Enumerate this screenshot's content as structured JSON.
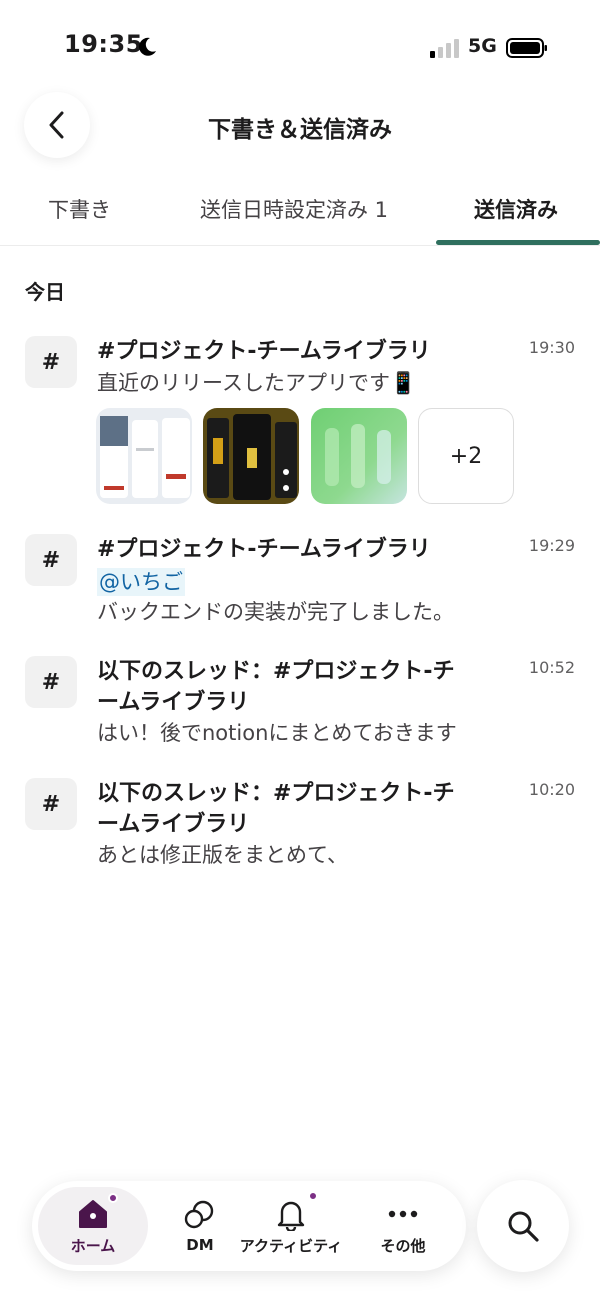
{
  "status_bar": {
    "time": "19:35",
    "network": "5G"
  },
  "header": {
    "title": "下書き＆送信済み"
  },
  "tabs": [
    {
      "label": "下書き",
      "active": false
    },
    {
      "label": "送信日時設定済み 1",
      "active": false
    },
    {
      "label": "送信済み",
      "active": true
    }
  ],
  "section": {
    "title": "今日"
  },
  "messages": [
    {
      "channel": "#プロジェクト-チームライブラリ",
      "time": "19:30",
      "text": "直近のリリースしたアプリです📱",
      "attachments_more": "+2"
    },
    {
      "channel": "#プロジェクト-チームライブラリ",
      "time": "19:29",
      "mention": "@いちご",
      "text": "バックエンドの実装が完了しました。"
    },
    {
      "channel_line1": "以下のスレッド：#プロジェクト-チ",
      "channel_line2": "ームライブラリ",
      "time": "10:52",
      "text": "はい！後でnotionにまとめておきます"
    },
    {
      "channel_line1": "以下のスレッド：#プロジェクト-チ",
      "channel_line2": "ームライブラリ",
      "time": "10:20",
      "text": "あとは修正版をまとめて、"
    }
  ],
  "hash_symbol": "#",
  "nav": {
    "home": "ホーム",
    "dm": "DM",
    "activity": "アクティビティ",
    "more": "その他"
  },
  "colors": {
    "accent_tab": "#2f6f5e",
    "badge": "#7c3085",
    "mention": "#1264a3",
    "home_active": "#4a154b"
  }
}
